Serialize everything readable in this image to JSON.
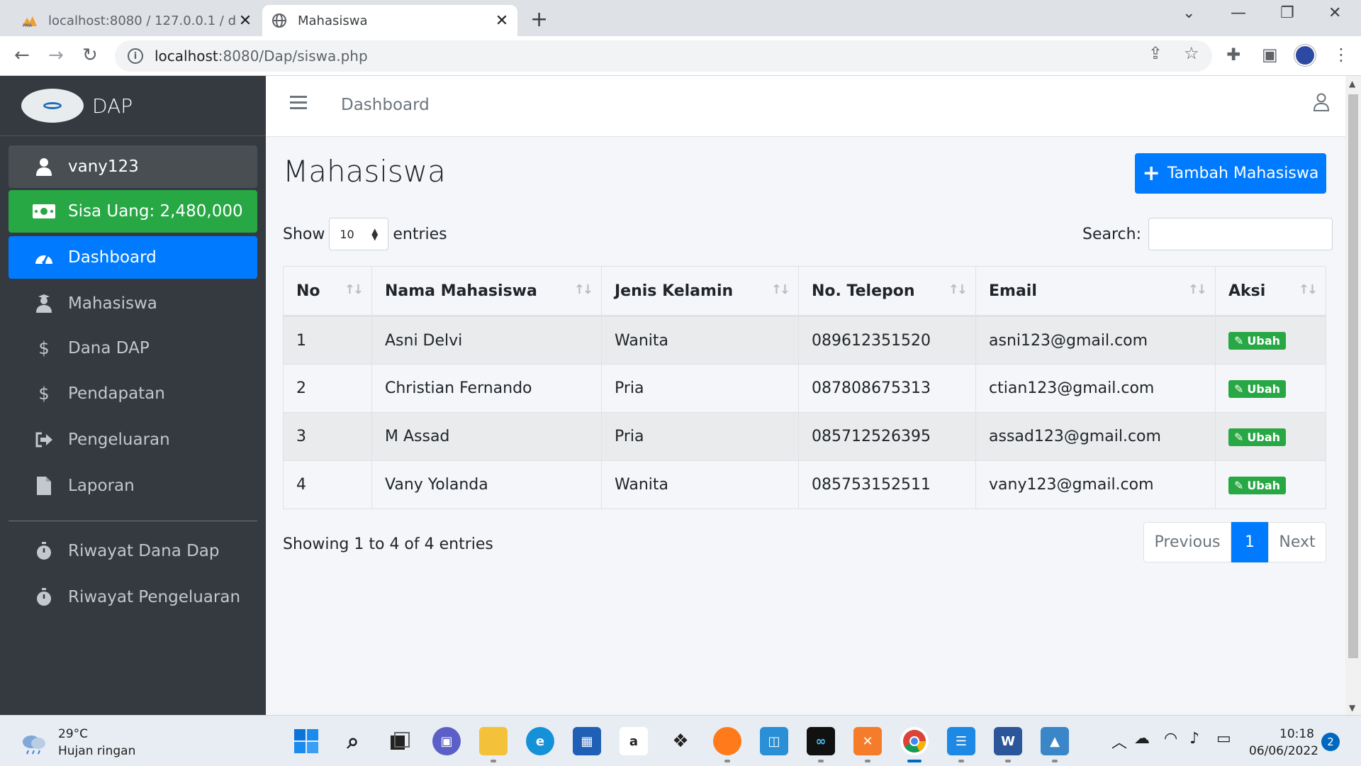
{
  "browser": {
    "tabs": [
      {
        "title": "localhost:8080 / 127.0.0.1 / dap /"
      },
      {
        "title": "Mahasiswa"
      }
    ],
    "url_host": "localhost",
    "url_path": ":8080/Dap/siswa.php"
  },
  "sidebar": {
    "brand": "DAP",
    "user": "vany123",
    "balance": "Sisa Uang: 2,480,000",
    "items": [
      {
        "label": "Dashboard",
        "icon": "tachometer-icon"
      },
      {
        "label": "Mahasiswa",
        "icon": "user-graduate-icon"
      },
      {
        "label": "Dana DAP",
        "icon": "dollar-icon"
      },
      {
        "label": "Pendapatan",
        "icon": "dollar-icon"
      },
      {
        "label": "Pengeluaran",
        "icon": "sign-out-icon"
      },
      {
        "label": "Laporan",
        "icon": "file-icon"
      },
      {
        "label": "Riwayat Dana Dap",
        "icon": "stopwatch-icon"
      },
      {
        "label": "Riwayat Pengeluaran",
        "icon": "stopwatch-icon"
      }
    ]
  },
  "topnav": {
    "breadcrumb": "Dashboard"
  },
  "page": {
    "title": "Mahasiswa",
    "add_button": "Tambah Mahasiswa",
    "show_label": "Show",
    "entries_value": "10",
    "entries_label": "entries",
    "search_label": "Search:",
    "info": "Showing 1 to 4 of 4 entries"
  },
  "table": {
    "columns": [
      "No",
      "Nama Mahasiswa",
      "Jenis Kelamin",
      "No. Telepon",
      "Email",
      "Aksi"
    ],
    "rows": [
      {
        "no": "1",
        "nama": "Asni Delvi",
        "jk": "Wanita",
        "telp": "089612351520",
        "email": "asni123@gmail.com"
      },
      {
        "no": "2",
        "nama": "Christian Fernando",
        "jk": "Pria",
        "telp": "087808675313",
        "email": "ctian123@gmail.com"
      },
      {
        "no": "3",
        "nama": "M Assad",
        "jk": "Pria",
        "telp": "085712526395",
        "email": "assad123@gmail.com"
      },
      {
        "no": "4",
        "nama": "Vany Yolanda",
        "jk": "Wanita",
        "telp": "085753152511",
        "email": "vany123@gmail.com"
      }
    ],
    "action_label": "Ubah"
  },
  "pagination": {
    "previous": "Previous",
    "current": "1",
    "next": "Next"
  },
  "taskbar": {
    "temperature": "29°C",
    "weather": "Hujan ringan",
    "time": "10:18",
    "date": "06/06/2022",
    "notifications": "2"
  },
  "colors": {
    "primary": "#007bff",
    "success": "#28a745",
    "sidebar": "#343a40"
  }
}
